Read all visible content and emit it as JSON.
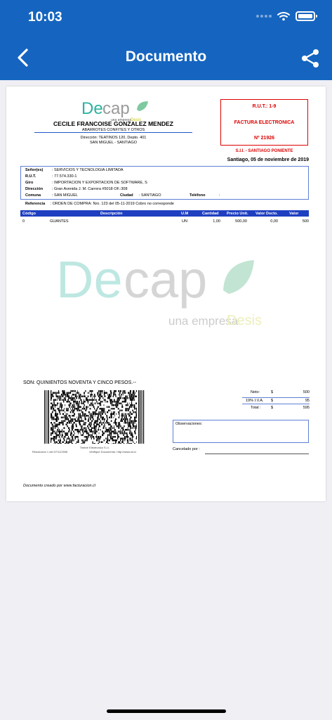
{
  "status_bar": {
    "time": "10:03"
  },
  "header": {
    "title": "Documento",
    "back_icon": "chevron-left-icon",
    "share_icon": "share-icon"
  },
  "colors": {
    "header_bg": "#1565c0",
    "accent_red": "#dd0000",
    "table_header": "#1f3fc1",
    "logo_teal": "#2bb3a0",
    "logo_grey": "#9a9a9a",
    "logo_green": "#5cb85c",
    "desis_yellow": "#c8c820"
  },
  "document": {
    "logo": {
      "part1": "De",
      "part2": "cap",
      "tag_prefix": "una empresa",
      "tag_brand": "Desis"
    },
    "company": {
      "name": "CECILE FRANCOISE GONZALEZ MENDEZ",
      "activity": "ABARROTES CONFITES Y OTROS",
      "address": "Dirección: TEATINOS 120, Depto. 401",
      "city": "SAN MIGUEL - SANTIAGO"
    },
    "rut_box": {
      "rut": "R.U.T.: 1-9",
      "type": "FACTURA ELECTRONICA",
      "number": "Nº 21926"
    },
    "sii": "S.I.I. - SANTIAGO PONIENTE",
    "date": "Santiago, 05 de noviembre de 2019",
    "client": {
      "senores_label": "Señor(es)",
      "senores": ": SERVICIOS Y TECNOLOGIA LIMITADA",
      "rut_label": "R.U.T.",
      "rut": ": 77.574.330-1",
      "giro_label": "Giro",
      "giro": ": IMPORTACION Y EXPORTACION DE SOFTWARE, S",
      "direccion_label": "Dirección",
      "direccion": ": Gran Avenida J. M. Carrera #5018 OF.:308",
      "comuna_label": "Comuna",
      "comuna": ": SAN MIGUEL",
      "ciudad_label": "Ciudad",
      "ciudad": ": SANTIAGO",
      "telefono_label": "Teléfono",
      "telefono": ":"
    },
    "referencia": {
      "label": "Referencia",
      "value": ": ORDEN DE COMPRA: Nro. 123 del 05-11-2019 Cobro no corresponde"
    },
    "table": {
      "headers": [
        "Código",
        "Descripción",
        "U.M",
        "Cantidad",
        "Precio Unit.",
        "Valor Dscto.",
        "Valor"
      ],
      "rows": [
        [
          "0",
          "GUANTES",
          "UN",
          "1,00",
          "500,00",
          "0,00",
          "500"
        ]
      ]
    },
    "son": "SON: QUINIENTOS NOVENTA Y CINCO PESOS.--",
    "timbre": {
      "title": "Timbre Electronico S.I.I.",
      "resolucion": "Resolución 1 del 07/11/2006",
      "verifique": "Verifique Documento: http://www.sii.cl"
    },
    "totals": {
      "neto_label": "Neto:",
      "neto_cur": "$",
      "neto": "500",
      "iva_label": "19% I.V.A.",
      "iva_cur": "$",
      "iva": "95",
      "total_label": "Total :",
      "total_cur": "$",
      "total": "595"
    },
    "observaciones_label": "Observaciones:",
    "cancelado_label": "Cancelado por :",
    "creado": "Documento creado por www.facturacion.cl"
  }
}
